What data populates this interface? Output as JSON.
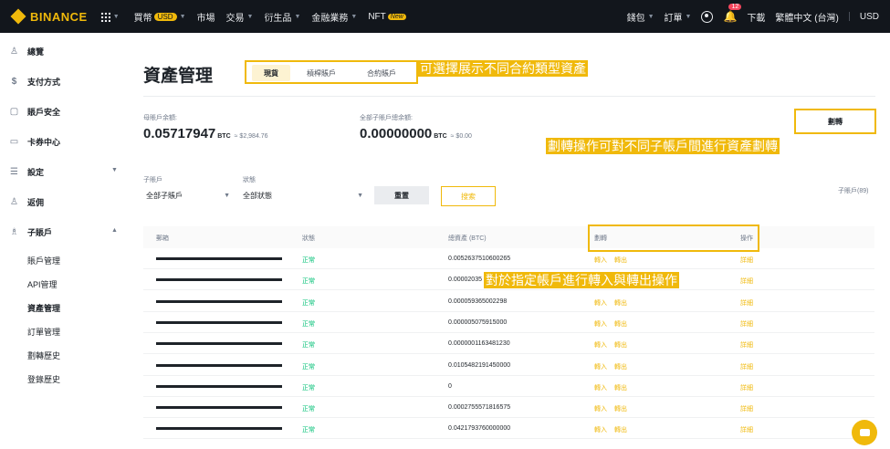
{
  "topbar": {
    "brand": "BINANCE",
    "nav": [
      {
        "label": "買幣",
        "badge": "USD"
      },
      {
        "label": "市場"
      },
      {
        "label": "交易"
      },
      {
        "label": "衍生品"
      },
      {
        "label": "金融業務"
      },
      {
        "label": "NFT",
        "badge": "New"
      }
    ],
    "right": {
      "wallet": "錢包",
      "orders": "訂單",
      "notifications_count": "12",
      "download": "下載",
      "language": "繁體中文 (台灣)",
      "currency": "USD"
    }
  },
  "sidebar": {
    "items": [
      {
        "label": "總覽",
        "icon": "person-icon"
      },
      {
        "label": "支付方式",
        "icon": "dollar-circle-icon"
      },
      {
        "label": "賬戶安全",
        "icon": "shield-icon"
      },
      {
        "label": "卡券中心",
        "icon": "ticket-icon"
      },
      {
        "label": "設定",
        "icon": "sliders-icon"
      },
      {
        "label": "返佣",
        "icon": "add-user-icon"
      },
      {
        "label": "子賬戶",
        "icon": "group-icon"
      }
    ],
    "subitems": [
      "賬戶管理",
      "API管理",
      "資產管理",
      "訂單管理",
      "劃轉歷史",
      "登錄歷史"
    ]
  },
  "page": {
    "title": "資產管理",
    "tabs": [
      "現貨",
      "槓桿賬戶",
      "合約賬戶"
    ],
    "annotation_tabs": "可選擇展示不同合約類型資產",
    "annotation_transfer": "劃轉操作可對不同子帳戶間進行資產劃轉",
    "annotation_ops": "對於指定帳戶進行轉入與轉出操作"
  },
  "balances": {
    "master_label": "母賬戶余額:",
    "master_value": "0.05717947",
    "master_unit": "BTC",
    "master_usd": "≈ $2,984.76",
    "sub_label": "全部子賬戶總余額:",
    "sub_value": "0.00000000",
    "sub_unit": "BTC",
    "sub_usd": "≈ $0.00"
  },
  "actions": {
    "transfer": "劃轉"
  },
  "filters": {
    "sub_label": "子賬戶",
    "sub_value": "全部子賬戶",
    "status_label": "狀態",
    "status_value": "全部狀態",
    "reset": "重置",
    "search": "搜索",
    "sub_count": "子賬戶(89)"
  },
  "table": {
    "headers": [
      "郵箱",
      "狀態",
      "總資產 (BTC)",
      "劃轉",
      "操作"
    ],
    "transfer_in": "轉入",
    "transfer_out": "轉出",
    "detail": "詳細",
    "rows": [
      {
        "status": "正常",
        "total": "0.0052637510600265"
      },
      {
        "status": "正常",
        "total": "0.00002035"
      },
      {
        "status": "正常",
        "total": "0.000059365002298"
      },
      {
        "status": "正常",
        "total": "0.000005075915000"
      },
      {
        "status": "正常",
        "total": "0.0000001163481230"
      },
      {
        "status": "正常",
        "total": "0.0105482191450000"
      },
      {
        "status": "正常",
        "total": "0"
      },
      {
        "status": "正常",
        "total": "0.0002755571816575"
      },
      {
        "status": "正常",
        "total": "0.0421793760000000"
      }
    ]
  }
}
